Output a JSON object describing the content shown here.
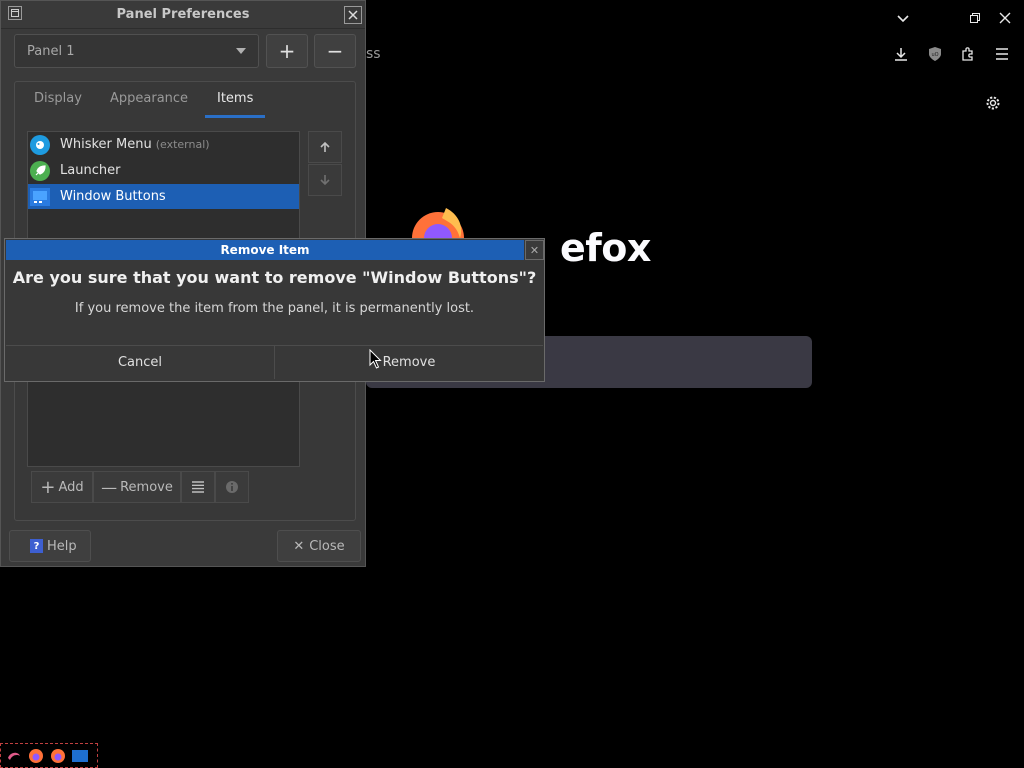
{
  "prefs": {
    "title": "Panel Preferences",
    "panel_select": "Panel 1",
    "add_panel": "+",
    "remove_panel": "−",
    "tabs": [
      {
        "label": "Display"
      },
      {
        "label": "Appearance"
      },
      {
        "label": "Items"
      }
    ],
    "items": [
      {
        "label": "Whisker Menu",
        "sub": "(external)"
      },
      {
        "label": "Launcher",
        "sub": ""
      },
      {
        "label": "Window Buttons",
        "sub": ""
      }
    ],
    "toolbar": {
      "add": "Add",
      "remove": "Remove"
    },
    "help": "Help",
    "close": "Close"
  },
  "dialog": {
    "title": "Remove Item",
    "heading": "Are you sure that you want to remove \"Window Buttons\"?",
    "message": "If you remove the item from the panel, it is permanently lost.",
    "cancel": "Cancel",
    "remove": "Remove"
  },
  "firefox": {
    "wordmark": "efox",
    "partial_text": "ss"
  },
  "colors": {
    "accent": "#1d5fb4",
    "window_bg": "#3a3a3a",
    "desktop": "#000000"
  }
}
